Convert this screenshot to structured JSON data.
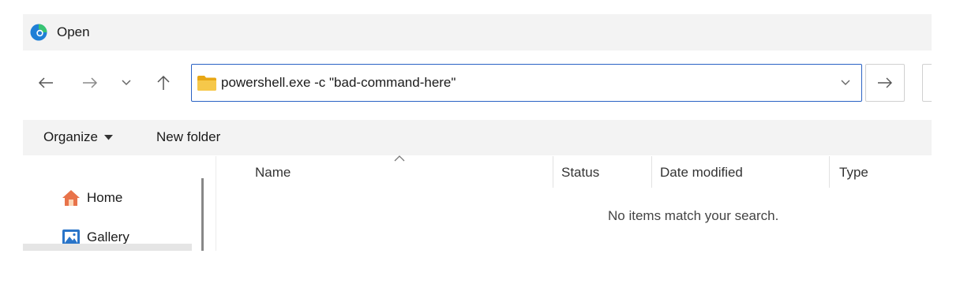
{
  "window": {
    "title": "Open",
    "app_icon": "edge-logo-icon"
  },
  "nav": {
    "back_icon": "arrow-left-icon",
    "forward_icon": "arrow-right-icon",
    "recent_icon": "chevron-down-icon",
    "up_icon": "arrow-up-icon"
  },
  "address_bar": {
    "value": "powershell.exe -c \"bad-command-here\"",
    "folder_icon": "folder-icon",
    "dropdown_icon": "chevron-down-icon",
    "go_icon": "arrow-right-icon"
  },
  "toolbar": {
    "organize_label": "Organize",
    "new_folder_label": "New folder"
  },
  "sidebar": {
    "items": [
      {
        "label": "Home",
        "icon": "home-icon"
      },
      {
        "label": "Gallery",
        "icon": "gallery-icon"
      }
    ]
  },
  "file_list": {
    "columns": [
      "Name",
      "Status",
      "Date modified",
      "Type"
    ],
    "sorted_column": "Name",
    "empty_message": "No items match your search."
  },
  "colors": {
    "accent": "#2a62c4",
    "folder": "#f4c342",
    "home": "#e8734a",
    "gallery": "#2a75c9"
  }
}
